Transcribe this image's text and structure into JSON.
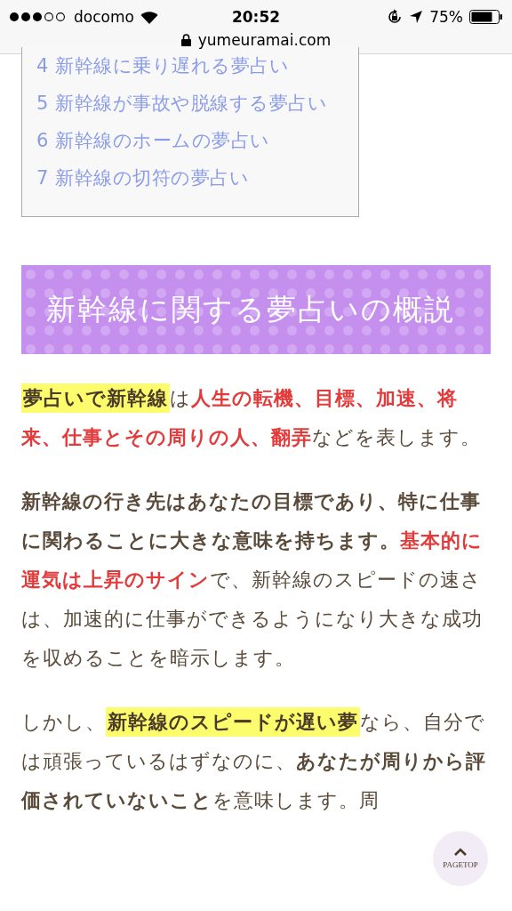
{
  "status_bar": {
    "carrier": "docomo",
    "time": "20:52",
    "battery": "75%"
  },
  "address_bar": {
    "url": "yumeuramai.com"
  },
  "toc": {
    "items": [
      {
        "number": "4",
        "title": "新幹線に乗り遅れる夢占い"
      },
      {
        "number": "5",
        "title": "新幹線が事故や脱線する夢占い"
      },
      {
        "number": "6",
        "title": "新幹線のホームの夢占い"
      },
      {
        "number": "7",
        "title": "新幹線の切符の夢占い"
      }
    ]
  },
  "heading": "新幹線に関する夢占いの概説",
  "paragraphs": [
    {
      "segments": [
        {
          "kind": "marker",
          "text": "夢占いで新幹線"
        },
        {
          "kind": "plain",
          "text": "は"
        },
        {
          "kind": "red",
          "text": "人生の転機、目標、加速、将来、仕事とその周りの人、翻弄"
        },
        {
          "kind": "plain",
          "text": "などを表します。"
        }
      ]
    },
    {
      "segments": [
        {
          "kind": "bold",
          "text": "新幹線の行き先はあなたの目標であり、特に仕事に関わることに大きな意味を持ちます。"
        },
        {
          "kind": "red",
          "text": "基本的に運気は上昇のサイン"
        },
        {
          "kind": "plain",
          "text": "で、新幹線のスピードの速さは、加速的に仕事ができるようになり大きな成功を収めることを暗示します。"
        }
      ]
    },
    {
      "segments": [
        {
          "kind": "plain",
          "text": "しかし、"
        },
        {
          "kind": "marker",
          "text": "新幹線のスピードが遅い夢"
        },
        {
          "kind": "plain",
          "text": "なら、自分では頑張っているはずなのに、"
        },
        {
          "kind": "bold",
          "text": "あなたが周りから評価されていないこと"
        },
        {
          "kind": "plain",
          "text": "を意味します。周"
        }
      ]
    }
  ],
  "page_top": {
    "label": "PAGETOP"
  }
}
